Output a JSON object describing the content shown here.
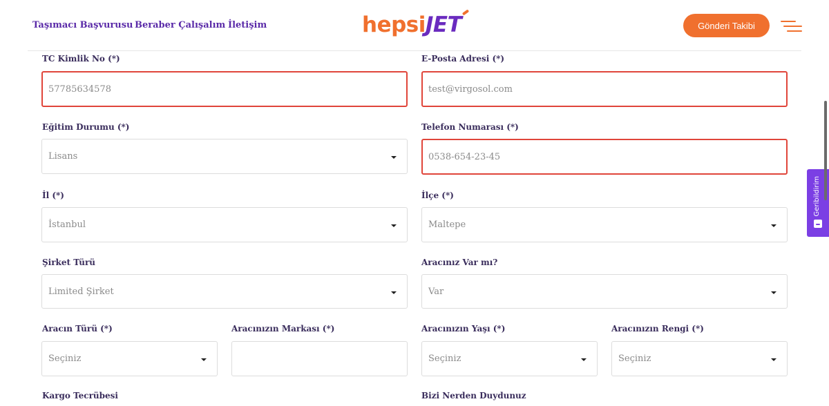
{
  "header": {
    "nav": [
      {
        "label": "Taşımacı Başvurusu"
      },
      {
        "label": "Beraber Çalışalım"
      },
      {
        "label": "İletişim"
      }
    ],
    "logo": {
      "part1": "hepsi",
      "part2": "JET"
    },
    "track_button": "Gönderi Takibi",
    "colors": {
      "brand_orange": "#f0702e",
      "brand_purple": "#5a2aa8",
      "error_red": "#e0453a"
    }
  },
  "form": {
    "tc": {
      "label": "TC Kimlik No (*)",
      "value": "57785634578"
    },
    "email": {
      "label": "E-Posta Adresi (*)",
      "value": "test@virgosol.com"
    },
    "education": {
      "label": "Eğitim Durumu (*)",
      "value": "Lisans"
    },
    "phone": {
      "label": "Telefon Numarası (*)",
      "value": "0538-654-23-45"
    },
    "city": {
      "label": "İl (*)",
      "value": "İstanbul"
    },
    "district": {
      "label": "İlçe (*)",
      "value": "Maltepe"
    },
    "company_type": {
      "label": "Şirket Türü",
      "value": "Limited Şirket"
    },
    "has_vehicle": {
      "label": "Aracınız Var mı?",
      "value": "Var"
    },
    "vehicle_type": {
      "label": "Aracın Türü (*)",
      "value": "Seçiniz"
    },
    "vehicle_brand": {
      "label": "Aracınızın Markası (*)",
      "value": ""
    },
    "vehicle_age": {
      "label": "Aracınızın Yaşı (*)",
      "value": "Seçiniz"
    },
    "vehicle_color": {
      "label": "Aracınızın Rengi (*)",
      "value": "Seçiniz"
    },
    "cargo_experience": {
      "label": "Kargo Tecrübesi"
    },
    "referral": {
      "label": "Bizi Nerden Duydunuz"
    }
  },
  "feedback_widget": {
    "label": "Geribildirim",
    "icon": "feedback-face-icon"
  }
}
